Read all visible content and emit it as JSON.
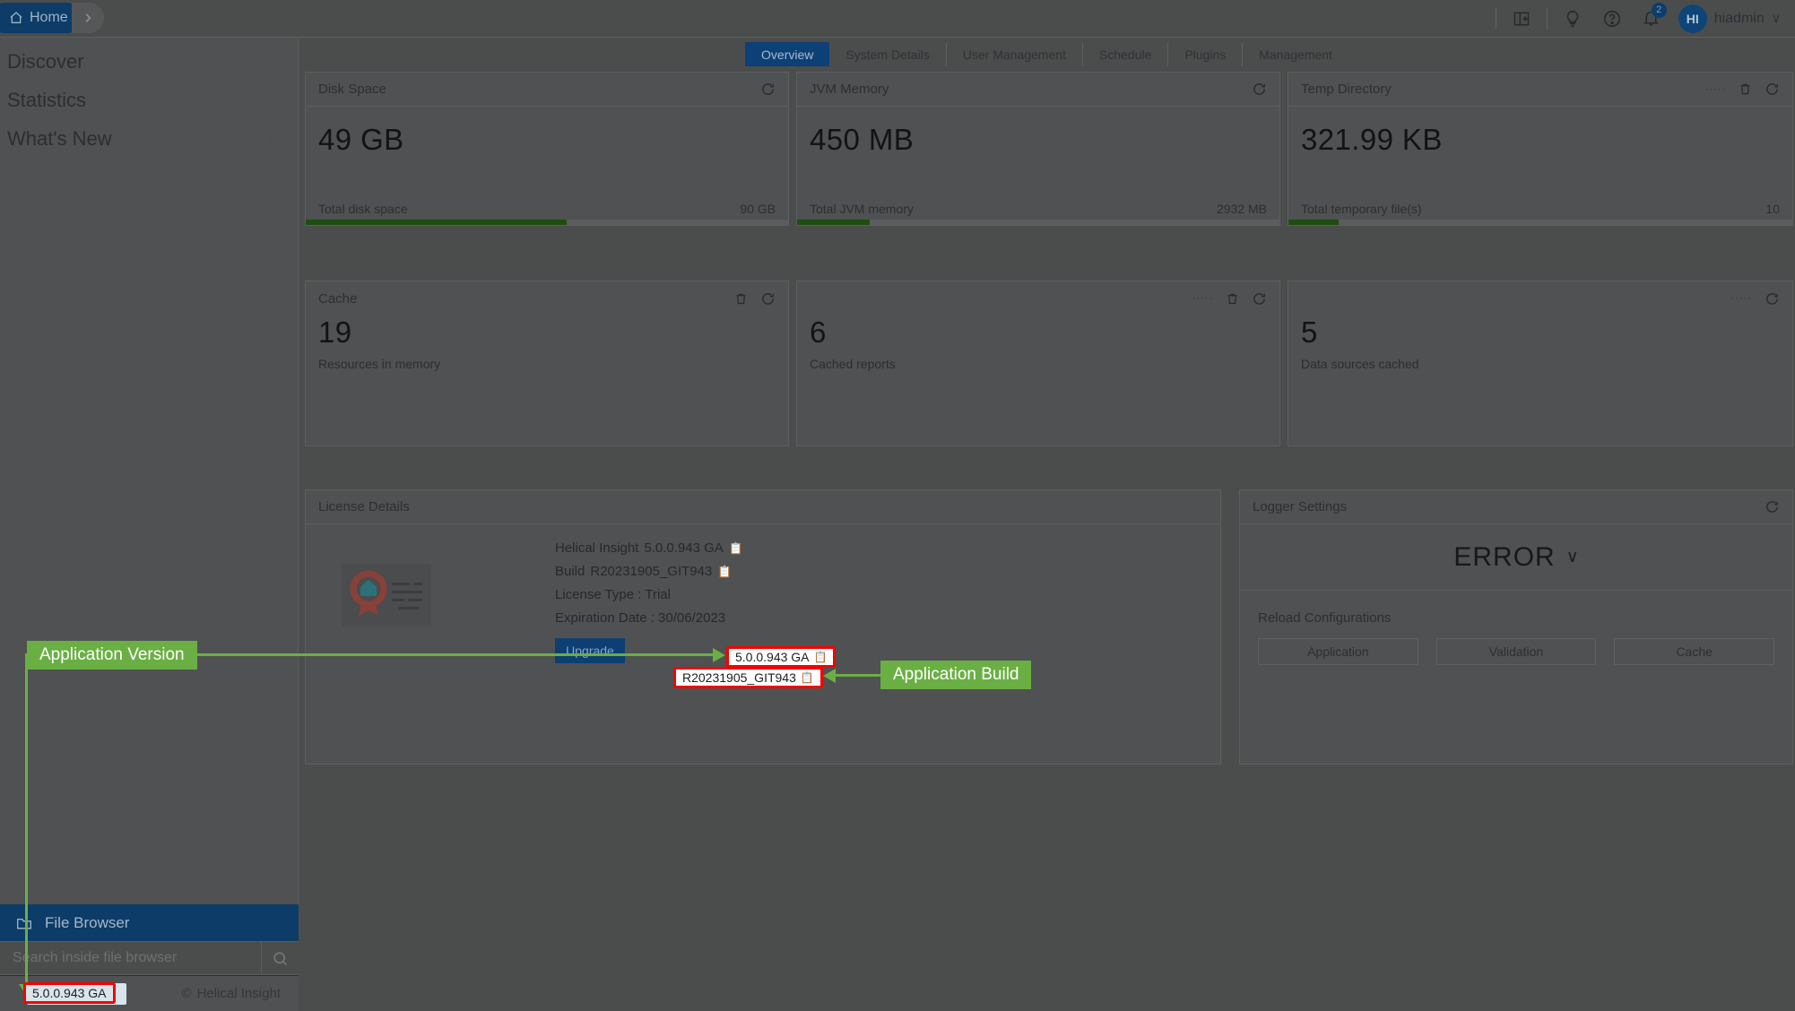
{
  "sidebar": {
    "breadcrumb": {
      "home_label": "Home",
      "home_icon": "home-icon",
      "chevron_icon": "chevron-right-icon"
    },
    "nav_items": [
      {
        "label": "Discover",
        "chevron": "∨"
      },
      {
        "label": "Statistics",
        "chevron": "∨"
      },
      {
        "label": "What's New",
        "chevron": "∨"
      }
    ],
    "file_browser": {
      "label": "File Browser",
      "icon": "folder-icon",
      "search_placeholder": "Search inside file browser",
      "search_value": "",
      "search_icon": "search-icon"
    },
    "footer": {
      "version": "5.0.0.943 GA",
      "brand": "Helical Insight",
      "copyright_mark": "©"
    }
  },
  "topbar": {
    "icons": [
      {
        "name": "panel-toggle-icon"
      },
      {
        "name": "bulb-icon"
      },
      {
        "name": "help-icon"
      },
      {
        "name": "bell-icon"
      }
    ],
    "notification_count": "2",
    "user": {
      "initials": "HI",
      "name": "hiadmin",
      "chevron": "∨"
    }
  },
  "tabs": [
    {
      "label": "Overview",
      "active": true
    },
    {
      "label": "System Details",
      "active": false
    },
    {
      "label": "User Management",
      "active": false
    },
    {
      "label": "Schedule",
      "active": false
    },
    {
      "label": "Plugins",
      "active": false
    },
    {
      "label": "Management",
      "active": false
    }
  ],
  "cards": {
    "disk": {
      "title": "Disk Space",
      "value": "49 GB",
      "foot_label": "Total disk space",
      "foot_value": "90 GB",
      "progress_percent": 54,
      "refresh_icon": "refresh-icon"
    },
    "jvm": {
      "title": "JVM Memory",
      "value": "450 MB",
      "foot_label": "Total JVM memory",
      "foot_value": "2932 MB",
      "progress_percent": 15,
      "refresh_icon": "refresh-icon"
    },
    "temp": {
      "title": "Temp Directory",
      "value": "321.99 KB",
      "foot_label": "Total temporary file(s)",
      "foot_value": "10",
      "progress_percent": 10,
      "dots": "·····",
      "delete_icon": "trash-icon",
      "refresh_icon": "refresh-icon"
    },
    "cache": {
      "title": "Cache",
      "value": "19",
      "sub_label": "Resources in memory",
      "delete_icon": "trash-icon",
      "refresh_icon": "refresh-icon"
    },
    "cached_reports": {
      "title": "",
      "value": "6",
      "sub_label": "Cached reports",
      "dots": "·····",
      "delete_icon": "trash-icon",
      "refresh_icon": "refresh-icon"
    },
    "data_sources": {
      "title": "",
      "value": "5",
      "sub_label": "Data sources cached",
      "dots": "·····",
      "refresh_icon": "refresh-icon"
    }
  },
  "license": {
    "title": "License Details",
    "image_icon": "certificate-icon",
    "product_label": "Helical Insight",
    "product_version": "5.0.0.943 GA",
    "build_label": "Build",
    "build_value": "R20231905_GIT943",
    "license_type": "License Type : Trial",
    "expiration": "Expiration Date : 30/06/2023",
    "upgrade_label": "Upgrade",
    "copy_icon": "copy-icon"
  },
  "logger": {
    "title": "Logger Settings",
    "level": "ERROR",
    "chevron": "∨",
    "refresh_icon": "refresh-icon",
    "reload_title": "Reload Configurations",
    "buttons": [
      {
        "label": "Application"
      },
      {
        "label": "Validation"
      },
      {
        "label": "Cache"
      }
    ]
  },
  "annotations": [
    {
      "label": "Application Version"
    },
    {
      "label": "Application Build"
    }
  ],
  "colors": {
    "brand_blue": "#0d4076",
    "annotation_green": "#6aaf44",
    "annotation_red": "#f60000",
    "progress_green": "#1d4d10"
  }
}
